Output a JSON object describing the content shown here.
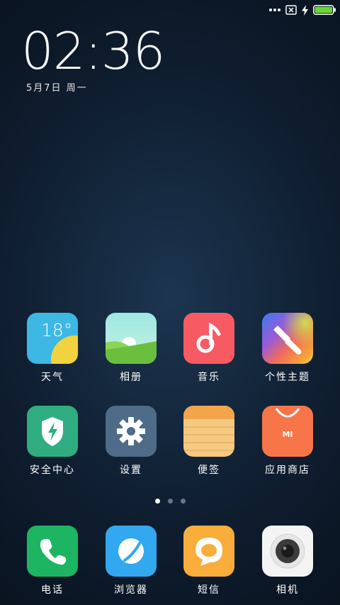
{
  "status_bar": {
    "icons": [
      "signal-dots-icon",
      "no-sim-icon",
      "charging-bolt-icon",
      "battery-icon"
    ],
    "battery_color": "#6bd53a"
  },
  "lockscreen": {
    "time": "02:36",
    "date": "5月7日 周一"
  },
  "apps_row1": [
    {
      "label": "天气",
      "icon": "weather-icon",
      "text": "18°"
    },
    {
      "label": "相册",
      "icon": "gallery-icon"
    },
    {
      "label": "音乐",
      "icon": "music-icon"
    },
    {
      "label": "个性主题",
      "icon": "themes-icon"
    }
  ],
  "apps_row2": [
    {
      "label": "安全中心",
      "icon": "security-icon"
    },
    {
      "label": "设置",
      "icon": "settings-icon"
    },
    {
      "label": "便签",
      "icon": "notes-icon"
    },
    {
      "label": "应用商店",
      "icon": "app-store-icon",
      "text": "MI"
    }
  ],
  "pager": {
    "pages": 3,
    "active": 1
  },
  "dock": [
    {
      "label": "电话",
      "icon": "phone-icon"
    },
    {
      "label": "浏览器",
      "icon": "browser-icon"
    },
    {
      "label": "短信",
      "icon": "messages-icon"
    },
    {
      "label": "相机",
      "icon": "camera-icon"
    }
  ]
}
